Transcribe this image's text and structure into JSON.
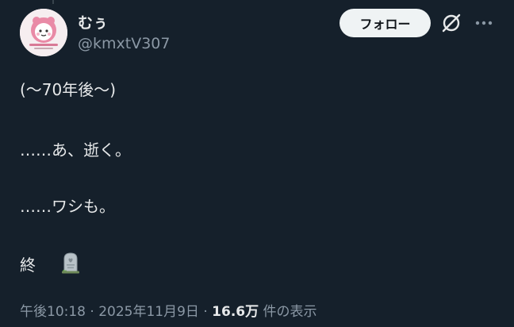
{
  "user": {
    "display_name": "むぅ",
    "handle": "@kmxtV307",
    "avatar_icon": "avatar-image"
  },
  "actions": {
    "follow_label": "フォロー",
    "grok_icon": "grok-icon",
    "more_icon": "more-icon"
  },
  "tweet": {
    "lines": [
      "(〜70年後〜)",
      "……あ、逝く。",
      "……ワシも。",
      "終"
    ],
    "emoji_icon": "headstone-icon"
  },
  "meta": {
    "time": "午後10:18",
    "separator": "·",
    "date": "2025年11月9日",
    "views_count": "16.6万",
    "views_label": "件の表示"
  },
  "colors": {
    "background": "#15202b",
    "text_primary": "#e7e9ea",
    "text_secondary": "#8b98a5",
    "follow_bg": "#eff3f4"
  }
}
